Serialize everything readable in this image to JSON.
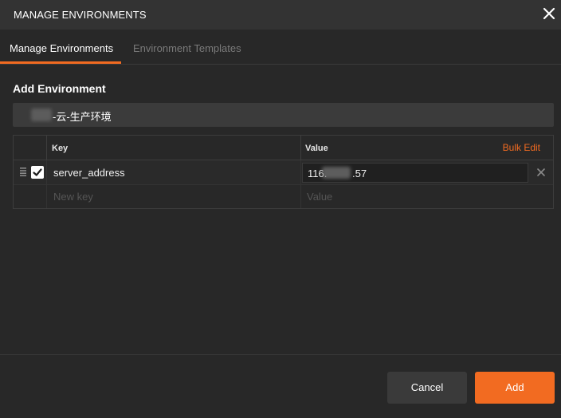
{
  "window": {
    "title": "MANAGE ENVIRONMENTS",
    "close_icon": "close-icon"
  },
  "tabs": [
    {
      "label": "Manage Environments",
      "active": true
    },
    {
      "label": "Environment Templates",
      "active": false
    }
  ],
  "form": {
    "section_title": "Add Environment",
    "environment_name_visible": "-云-生产环境"
  },
  "table": {
    "headers": {
      "key": "Key",
      "value": "Value"
    },
    "bulk_edit_label": "Bulk Edit",
    "rows": [
      {
        "enabled": true,
        "key": "server_address",
        "value_start": "116.",
        "value_end": ".57"
      }
    ],
    "new_row": {
      "key_placeholder": "New key",
      "value_placeholder": "Value"
    }
  },
  "footer": {
    "cancel_label": "Cancel",
    "add_label": "Add"
  },
  "colors": {
    "accent": "#f26b21",
    "background": "#282828"
  }
}
